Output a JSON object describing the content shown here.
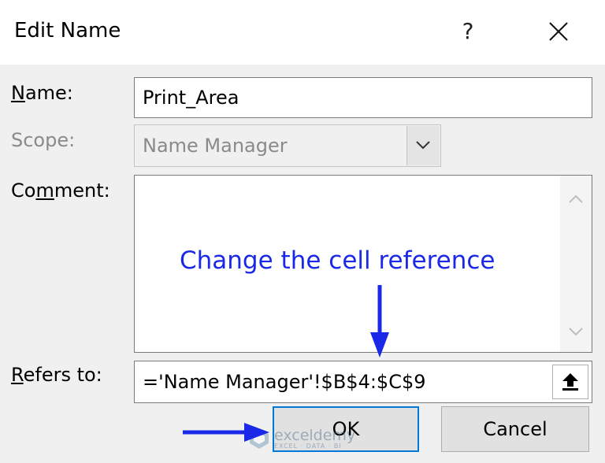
{
  "window": {
    "title": "Edit Name",
    "help_label": "?",
    "close_icon": "close-icon"
  },
  "form": {
    "name_label_first": "N",
    "name_label_rest": "ame:",
    "name_value": "Print_Area",
    "scope_label": "Scope:",
    "scope_value": "Name Manager",
    "comment_label_pre": "Co",
    "comment_label_u": "m",
    "comment_label_post": "ment:",
    "comment_value": "",
    "refers_label_first": "R",
    "refers_label_rest": "efers to:",
    "refers_value": "='Name Manager'!$B$4:$C$9"
  },
  "annotation": {
    "text": "Change the cell reference",
    "color": "#1a28e8"
  },
  "buttons": {
    "ok_label": "OK",
    "cancel_label": "Cancel"
  },
  "watermark": {
    "text": "exceldemy",
    "subtext": "EXCEL · DATA · BI"
  },
  "colors": {
    "accent": "#0078d7",
    "dialog_bg": "#f0f0f0",
    "disabled_text": "#8a8a8a"
  }
}
